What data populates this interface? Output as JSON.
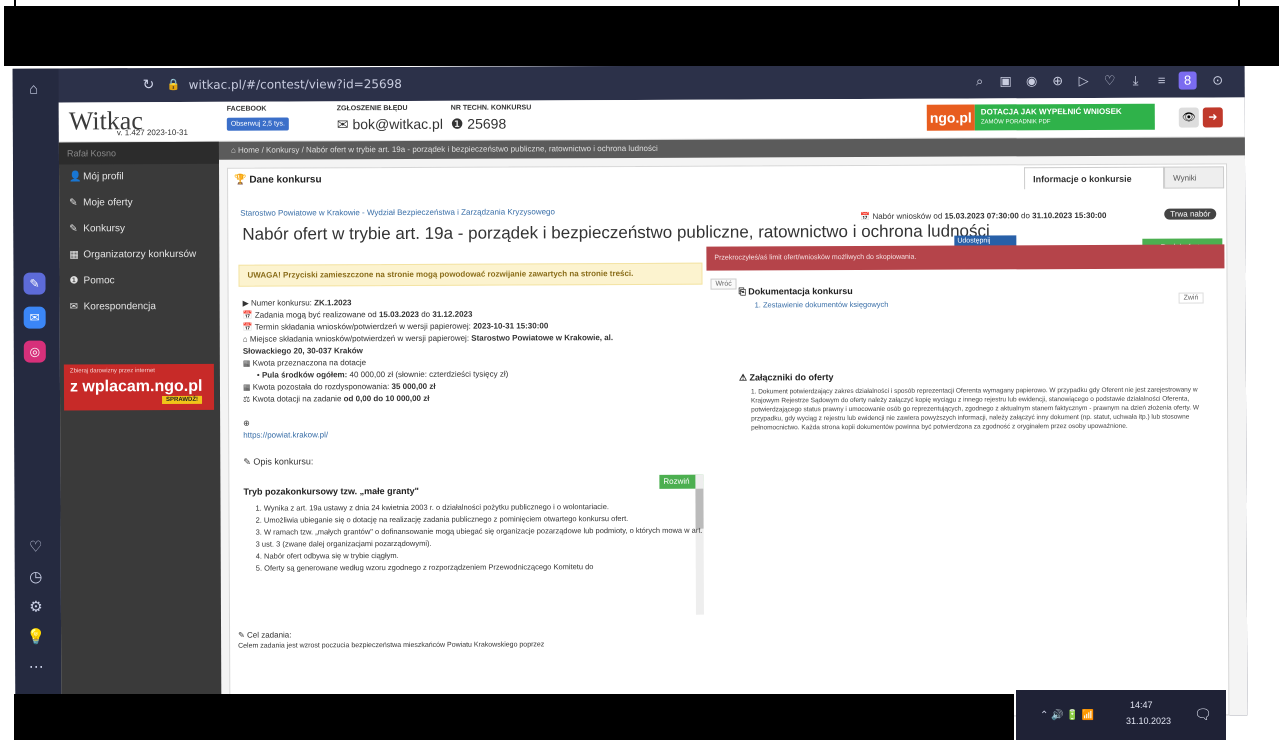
{
  "browser": {
    "url": "witkac.pl/#/contest/view?id=25698"
  },
  "header": {
    "logo": "Witkac",
    "version": "v. 1.427 2023-10-31",
    "facebook_label": "FACEBOOK",
    "facebook_button": "Obserwuj 2,5 tys.",
    "bug_label": "ZGŁOSZENIE BŁĘDU",
    "bug_email": "bok@witkac.pl",
    "contest_no_label": "NR TECHN. KONKURSU",
    "contest_no": "25698",
    "ngo_banner": "ngo.pl",
    "dotacja_line1": "DOTACJA JAK WYPEŁNIĆ WNIOSEK",
    "dotacja_line2": "ZAMÓW PORADNIK PDF"
  },
  "sidebar": {
    "user": "Rafał Kosno",
    "items": [
      {
        "label": "Mój profil",
        "icon": "user-icon"
      },
      {
        "label": "Moje oferty",
        "icon": "edit-icon"
      },
      {
        "label": "Konkursy",
        "icon": "edit-icon"
      },
      {
        "label": "Organizatorzy konkursów",
        "icon": "building-icon"
      },
      {
        "label": "Pomoc",
        "icon": "info-icon"
      },
      {
        "label": "Korespondencja",
        "icon": "mail-icon"
      }
    ],
    "ad": {
      "small": "Zbieraj darowizny przez internet",
      "big": "z wplacam.ngo.pl",
      "button": "SPRAWDŹ!"
    }
  },
  "breadcrumb": "Home / Konkursy / Nabór ofert w trybie art. 19a - porządek i bezpieczeństwo publiczne, ratownictwo i ochrona ludności",
  "card": {
    "title": "Dane konkursu",
    "tab_info": "Informacje o konkursie",
    "tab_results": "Wyniki",
    "organizer": "Starostwo Powiatowe w Krakowie - Wydział Bezpieczeństwa i Zarządzania Kryzysowego",
    "nabor_title": "Nabór ofert w trybie art. 19a - porządek i bezpieczeństwo publiczne, ratownictwo i ochrona ludności",
    "share": "Udostępnij",
    "dates_prefix": "Nabór wniosków od",
    "date_from": "15.03.2023 07:30:00",
    "dates_mid": "do",
    "date_to": "31.10.2023 15:30:00",
    "status": "Trwa nabór",
    "add_offer": "Dodaj ofertę",
    "warning": "UWAGA! Przyciski zamieszczone na stronie mogą powodować rozwijanie zawartych na stronie treści.",
    "alert": "Przekroczyłeś/aś limit ofert/wniosków możliwych do skopiowania.",
    "back": "Wróć",
    "info": {
      "number_label": "Numer konkursu:",
      "number": "ZK.1.2023",
      "tasks_label": "Zadania mogą być realizowane od",
      "tasks_from": "15.03.2023",
      "tasks_mid": "do",
      "tasks_to": "31.12.2023",
      "deadline_label": "Termin składania wniosków/potwierdzeń w wersji papierowej:",
      "deadline": "2023-10-31 15:30:00",
      "place_label": "Miejsce składania wniosków/potwierdzeń w wersji papierowej:",
      "place": "Starostwo Powiatowe w Krakowie, al.",
      "place2": "Słowackiego 20, 30-037 Kraków",
      "amount_label": "Kwota przeznaczona na dotacje",
      "pool_label": "Pula środków ogółem:",
      "pool": "40 000,00 zł (słownie: czterdzieści tysięcy zł)",
      "remaining_label": "Kwota pozostała do rozdysponowania:",
      "remaining": "35 000,00 zł",
      "per_task_label": "Kwota dotacji na zadanie",
      "per_task": "od 0,00 do 10 000,00 zł",
      "website": "https://powiat.krakow.pl/"
    },
    "opis_label": "Opis konkursu:",
    "tryb_title": "Tryb pozakonkursowy tzw. „małe granty\"",
    "expand": "Rozwiń",
    "tryb_items": [
      "1. Wynika z art. 19a ustawy z dnia 24 kwietnia 2003 r. o działalności pożytku publicznego i o wolontariacie.",
      "2. Umożliwia ubieganie się o dotację na realizację zadania publicznego z pominięciem otwartego konkursu ofert.",
      "3. W ramach tzw. „małych grantów\" o dofinansowanie mogą ubiegać się organizacje pozarządowe lub podmioty, o których mowa w art. 3 ust. 3 (zwane dalej organizacjami pozarządowymi).",
      "4. Nabór ofert odbywa się w trybie ciągłym.",
      "5. Oferty są generowane według wzoru zgodnego z rozporządzeniem Przewodniczącego Komitetu do"
    ],
    "cel_label": "Cel zadania:",
    "cel_text": "Celem zadania jest wzrost poczucia bezpieczeństwa mieszkańców Powiatu Krakowskiego poprzez",
    "docs_title": "Dokumentacja konkursu",
    "docs_link": "1. Zestawienie dokumentów księgowych",
    "collapse": "Zwiń",
    "att_title": "Załączniki do oferty",
    "att_text": "1. Dokument potwierdzający zakres działalności i sposób reprezentacji Oferenta wymagany papierowo. W przypadku gdy Oferent nie jest zarejestrowany w Krajowym Rejestrze Sądowym do oferty należy załączyć kopię wyciągu z innego rejestru lub ewidencji, stanowiącego o podstawie działalności Oferenta, potwierdzającego status prawny i umocowanie osób go reprezentujących, zgodnego z aktualnym stanem faktycznym - prawnym na dzień złożenia oferty. W przypadku, gdy wyciąg z rejestru lub ewidencji nie zawiera powyższych informacji, należy załączyć inny dokument (np. statut, uchwała itp.) lub stosowne pełnomocnictwo. Każda strona kopii dokumentów powinna być potwierdzona za zgodność z oryginałem przez osoby upoważnione."
  },
  "taskbar": {
    "time": "14:47",
    "date": "31.10.2023"
  }
}
